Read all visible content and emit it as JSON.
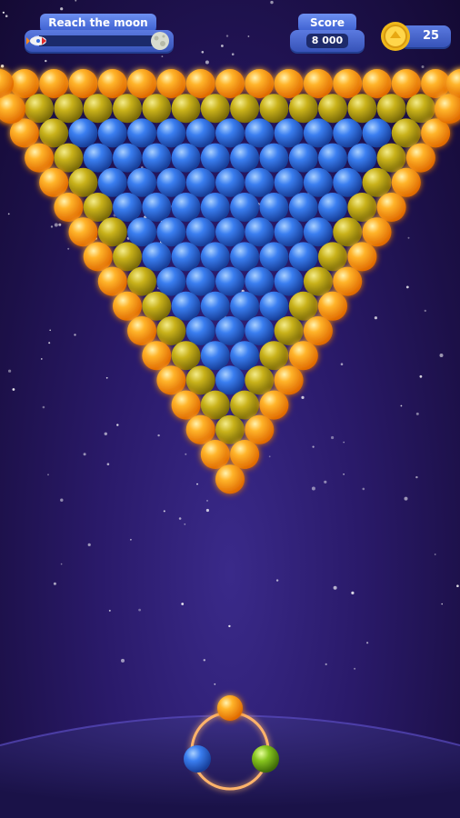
{
  "hud": {
    "goal_label": "Reach the moon",
    "goal_progress_percent": 5,
    "score_label": "Score",
    "score_value": "8 000",
    "coins": "25"
  },
  "board": {
    "shape": "inverted-triangle",
    "border_color": "#ff9a1a",
    "inner_colors": [
      "#c9b21a",
      "#2f6de0"
    ]
  },
  "shooter": {
    "current_ball_color": "#ff9a1a",
    "next_ball_colors": [
      "#2f6de0",
      "#7cc21a"
    ]
  },
  "colors": {
    "orange": "#ff9a1a",
    "yellow": "#c9b21a",
    "blue": "#2f6de0",
    "green": "#7cc21a"
  }
}
